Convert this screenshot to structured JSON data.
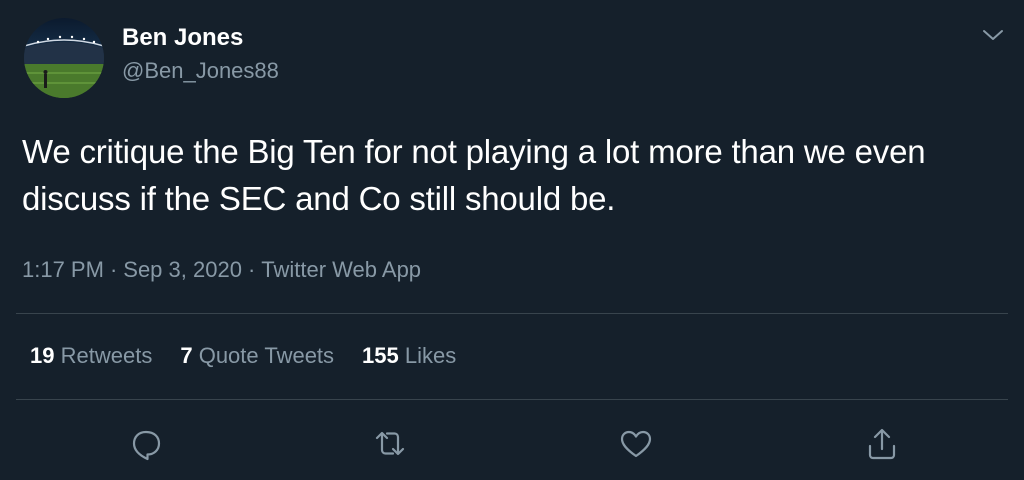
{
  "author": {
    "display_name": "Ben Jones",
    "handle": "@Ben_Jones88",
    "avatar_icon": "stadium-photo-avatar"
  },
  "tweet": {
    "text": "We critique the Big Ten for not playing a lot more than we even discuss if the SEC and Co still should be.",
    "time": "1:17 PM",
    "date": "Sep 3, 2020",
    "source": "Twitter Web App",
    "separator": "·"
  },
  "stats": {
    "retweets": {
      "count": "19",
      "label": "Retweets"
    },
    "quotes": {
      "count": "7",
      "label": "Quote Tweets"
    },
    "likes": {
      "count": "155",
      "label": "Likes"
    }
  },
  "actions": [
    {
      "icon": "reply-icon"
    },
    {
      "icon": "retweet-icon"
    },
    {
      "icon": "like-icon"
    },
    {
      "icon": "share-icon"
    }
  ],
  "colors": {
    "background": "#15202b",
    "primary_text": "#ffffff",
    "secondary_text": "#8899a6",
    "divider": "#38444d"
  }
}
